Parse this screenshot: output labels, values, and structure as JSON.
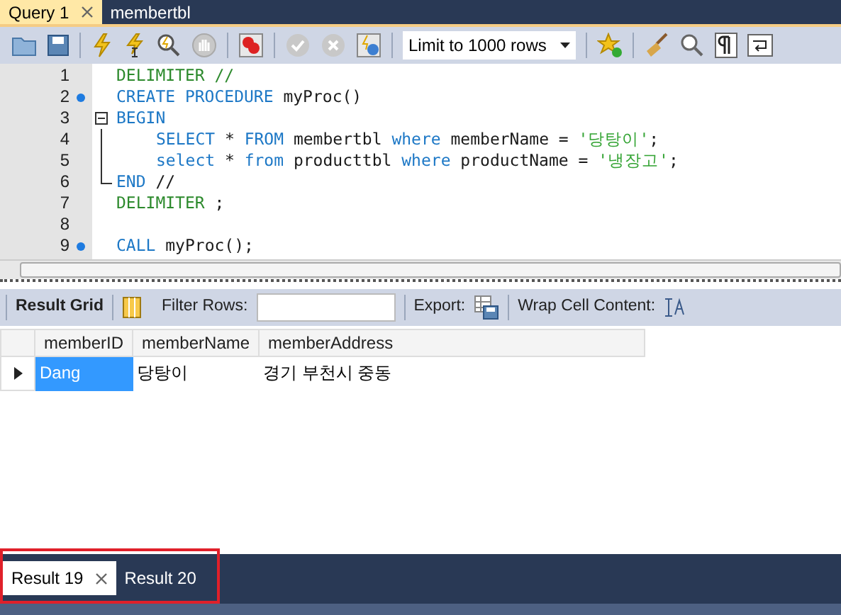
{
  "tabs": [
    {
      "label": "Query 1",
      "selected": true
    },
    {
      "label": "membertbl",
      "selected": false
    }
  ],
  "toolbar": {
    "limit": "Limit to 1000 rows"
  },
  "editor": {
    "lines": [
      {
        "number": "1",
        "marker": false,
        "tokens": [
          {
            "kind": "delimiter",
            "text": "DELIMITER //"
          }
        ]
      },
      {
        "number": "2",
        "marker": true,
        "tokens": [
          {
            "kind": "keyword",
            "text": "CREATE PROCEDURE "
          },
          {
            "kind": "text",
            "text": "myProc()"
          }
        ]
      },
      {
        "number": "3",
        "marker": false,
        "expanded": true,
        "tokens": [
          {
            "kind": "keyword",
            "text": "BEGIN"
          }
        ],
        "children": [
          {
            "number": "4",
            "marker": false,
            "indent": true,
            "tokens": [
              {
                "kind": "keyword",
                "text": "SELECT"
              },
              {
                "kind": "text",
                "text": " * "
              },
              {
                "kind": "keyword",
                "text": "FROM"
              },
              {
                "kind": "text",
                "text": " membertbl "
              },
              {
                "kind": "keyword",
                "text": "where"
              },
              {
                "kind": "text",
                "text": " memberName = "
              },
              {
                "kind": "string",
                "text": "'당탕이'"
              },
              {
                "kind": "text",
                "text": ";"
              }
            ]
          },
          {
            "number": "5",
            "marker": false,
            "indent": true,
            "tokens": [
              {
                "kind": "keyword",
                "text": "select"
              },
              {
                "kind": "text",
                "text": " * "
              },
              {
                "kind": "keyword",
                "text": "from"
              },
              {
                "kind": "text",
                "text": " producttbl "
              },
              {
                "kind": "keyword",
                "text": "where"
              },
              {
                "kind": "text",
                "text": " productName = "
              },
              {
                "kind": "string",
                "text": "'냉장고'"
              },
              {
                "kind": "text",
                "text": ";"
              }
            ]
          },
          {
            "number": "6",
            "marker": false,
            "tokens": [
              {
                "kind": "keyword",
                "text": "END"
              },
              {
                "kind": "text",
                "text": " //"
              }
            ]
          }
        ]
      },
      {
        "number": "7",
        "marker": false,
        "tokens": [
          {
            "kind": "delimiter",
            "text": "DELIMITER"
          },
          {
            "kind": "text",
            "text": " ;"
          }
        ]
      },
      {
        "number": "8",
        "marker": false
      },
      {
        "number": "9",
        "marker": true,
        "tokens": [
          {
            "kind": "keyword",
            "text": "CALL"
          },
          {
            "kind": "text",
            "text": " myProc();"
          }
        ]
      }
    ]
  },
  "result_toolbar": {
    "title": "Result Grid",
    "filter_label": "Filter Rows:",
    "export_label": "Export:",
    "wrap_label": "Wrap Cell Content:"
  },
  "table": {
    "columns": [
      "memberID",
      "memberName",
      "memberAddress"
    ],
    "rows": [
      {
        "current": true,
        "cells": [
          {
            "text": "Dang",
            "selected": true
          },
          {
            "text": "당탕이",
            "selected": false
          },
          {
            "text": "경기 부천시 중동",
            "selected": false
          }
        ]
      }
    ]
  },
  "result_tabs": [
    {
      "label": "Result 19",
      "selected": true
    },
    {
      "label": "Result 20",
      "selected": false
    }
  ]
}
